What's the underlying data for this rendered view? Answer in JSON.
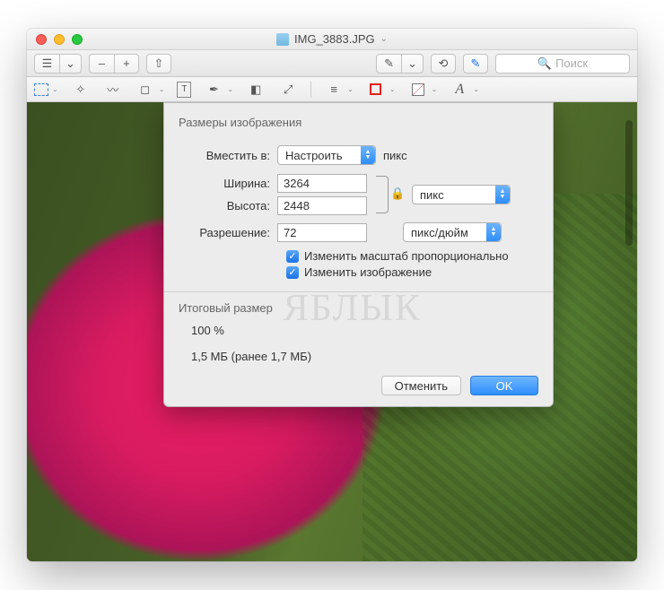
{
  "window": {
    "filename": "IMG_3883.JPG"
  },
  "toolbar": {
    "search_placeholder": "Поиск"
  },
  "editbar": {
    "font_letter": "A"
  },
  "dialog": {
    "title": "Размеры изображения",
    "fit_label": "Вместить в:",
    "fit_value": "Настроить",
    "fit_unit": "пикс",
    "width_label": "Ширина:",
    "width_value": "3264",
    "height_label": "Высота:",
    "height_value": "2448",
    "wh_unit": "пикс",
    "res_label": "Разрешение:",
    "res_value": "72",
    "res_unit": "пикс/дюйм",
    "scale_prop_label": "Изменить масштаб пропорционально",
    "resample_label": "Изменить изображение",
    "result_title": "Итоговый размер",
    "result_percent": "100 %",
    "result_size": "1,5 МБ (ранее 1,7 МБ)",
    "cancel": "Отменить",
    "ok": "OK"
  },
  "watermark": "ЯБЛЫК"
}
